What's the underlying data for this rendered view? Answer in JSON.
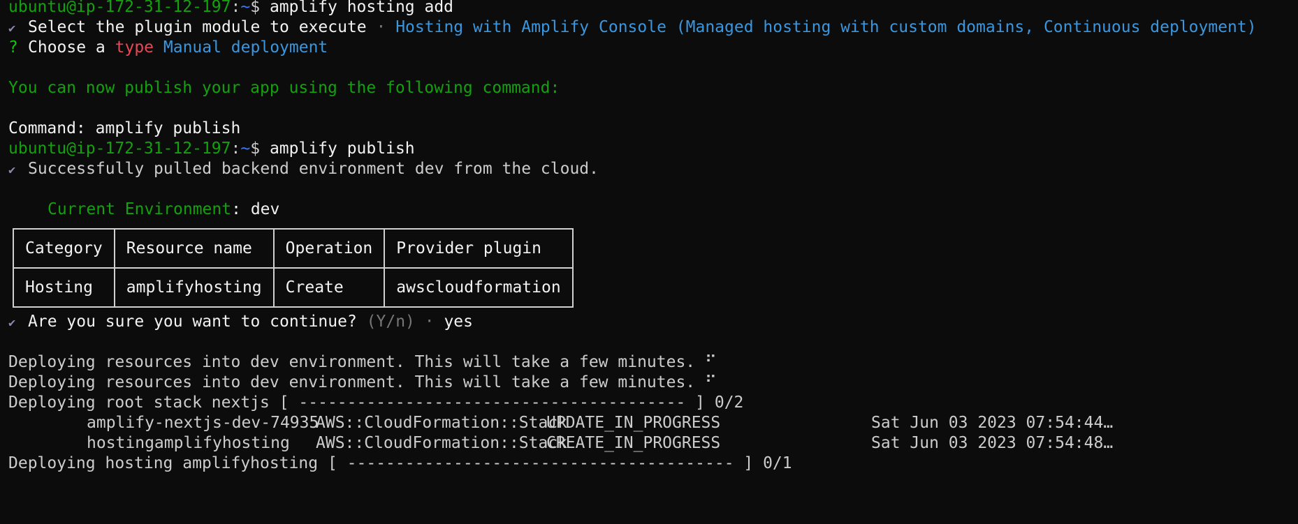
{
  "prompt": {
    "user_host": "ubuntu@ip-172-31-12-197",
    "sep": ":",
    "path": "~",
    "dollar": "$"
  },
  "commands": {
    "hosting_add": "amplify hosting add",
    "publish": "amplify publish"
  },
  "hosting_add_output": {
    "check_glyph": "✔",
    "question_glyph": "?",
    "select_plugin_label": "Select the plugin module to execute",
    "dot_sep": " · ",
    "select_plugin_value": "Hosting with Amplify Console (Managed hosting with custom domains, Continuous deployment)",
    "choose_prefix": "Choose a ",
    "choose_type_word": "type",
    "choose_value": "Manual deployment",
    "publish_hint": "You can now publish your app using the following command:",
    "command_line": "Command: amplify publish"
  },
  "publish_output": {
    "pulled_msg": "Successfully pulled backend environment dev from the cloud.",
    "current_env_label": "Current Environment",
    "current_env_sep": ": ",
    "current_env_value": "dev",
    "table": {
      "headers": [
        "Category",
        "Resource name",
        "Operation",
        "Provider plugin"
      ],
      "row": [
        "Hosting",
        "amplifyhosting",
        "Create",
        "awscloudformation"
      ]
    },
    "confirm_question": "Are you sure you want to continue?",
    "confirm_hint": " (Y/n)",
    "confirm_sep": " · ",
    "confirm_answer": "yes",
    "deploying_msg_1": "Deploying resources into dev environment. This will take a few minutes. ⠋",
    "deploying_msg_2": "Deploying resources into dev environment. This will take a few minutes. ⠋",
    "root_stack_line": "Deploying root stack nextjs [ ---------------------------------------- ] 0/2",
    "stacks": [
      {
        "name": "amplify-nextjs-dev-74935",
        "type": "AWS::CloudFormation::Stack",
        "status": "UPDATE_IN_PROGRESS",
        "time": "Sat Jun 03 2023 07:54:44…"
      },
      {
        "name": "hostingamplifyhosting",
        "type": "AWS::CloudFormation::Stack",
        "status": "CREATE_IN_PROGRESS",
        "time": "Sat Jun 03 2023 07:54:48…"
      }
    ],
    "hosting_line": "Deploying hosting amplifyhosting [ ---------------------------------------- ] 0/1"
  }
}
